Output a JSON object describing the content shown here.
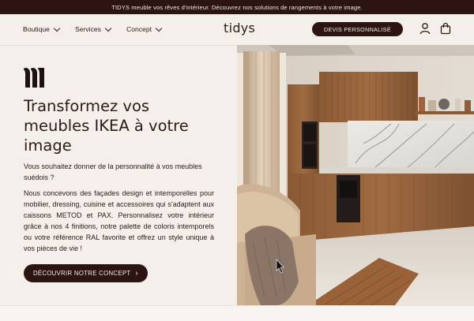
{
  "announcement": "TIDYS meuble vos rêves d'intérieur. Découvrez nos solutions de rangements à votre image.",
  "nav": {
    "items": [
      {
        "label": "Boutique"
      },
      {
        "label": "Services"
      },
      {
        "label": "Concept"
      }
    ],
    "logo": "tidys",
    "cta": "DEVIS PERSONNALISÉ",
    "icons": [
      "user-icon",
      "bag-icon"
    ]
  },
  "hero": {
    "title": "Transformez vos meubles IKEA à votre image",
    "intro": "Vous souhaitez donner de la personnalité à vos meubles suédois ?",
    "body": "Nous concevons des façades design et intemporelles pour mobilier, dressing, cuisine et accessoires qui s'adaptent aux caissons METOD et PAX. Personnalisez votre intérieur grâce à nos 4 finitions, notre palette de coloris intemporels ou votre référence RAL favorite et offrez un style unique à vos pièces de vie !",
    "cta": "DÉCOUVRIR NOTRE CONCEPT",
    "cta_arrow": "›"
  },
  "colors": {
    "dark_brown": "#2b1412",
    "background": "#f4efea"
  }
}
